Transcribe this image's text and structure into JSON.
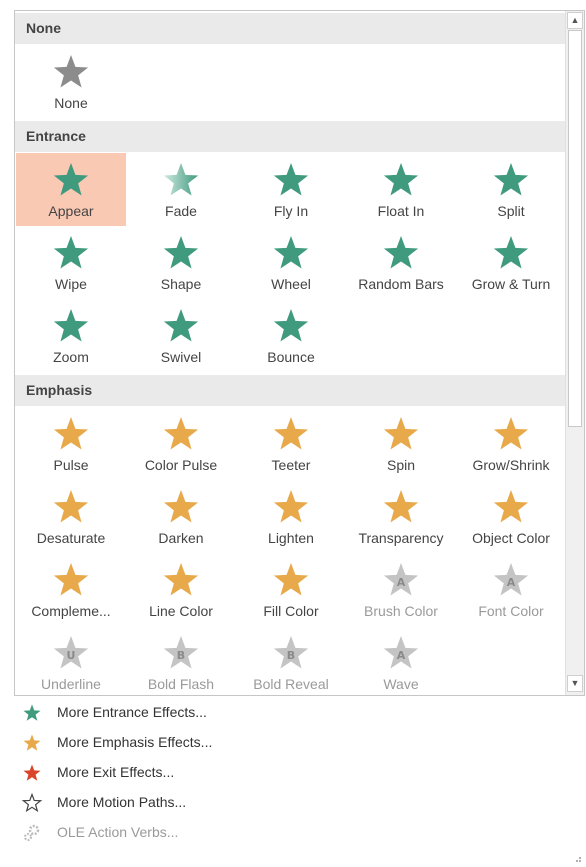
{
  "sections": [
    {
      "title": "None",
      "items": [
        {
          "label": "None",
          "kind": "none",
          "disabled": false,
          "selected": false
        }
      ]
    },
    {
      "title": "Entrance",
      "items": [
        {
          "label": "Appear",
          "kind": "entrance",
          "disabled": false,
          "selected": true
        },
        {
          "label": "Fade",
          "kind": "entrance",
          "disabled": false,
          "selected": false
        },
        {
          "label": "Fly In",
          "kind": "entrance",
          "disabled": false,
          "selected": false
        },
        {
          "label": "Float In",
          "kind": "entrance",
          "disabled": false,
          "selected": false
        },
        {
          "label": "Split",
          "kind": "entrance",
          "disabled": false,
          "selected": false
        },
        {
          "label": "Wipe",
          "kind": "entrance",
          "disabled": false,
          "selected": false
        },
        {
          "label": "Shape",
          "kind": "entrance",
          "disabled": false,
          "selected": false
        },
        {
          "label": "Wheel",
          "kind": "entrance",
          "disabled": false,
          "selected": false
        },
        {
          "label": "Random Bars",
          "kind": "entrance",
          "disabled": false,
          "selected": false
        },
        {
          "label": "Grow & Turn",
          "kind": "entrance",
          "disabled": false,
          "selected": false
        },
        {
          "label": "Zoom",
          "kind": "entrance",
          "disabled": false,
          "selected": false
        },
        {
          "label": "Swivel",
          "kind": "entrance",
          "disabled": false,
          "selected": false
        },
        {
          "label": "Bounce",
          "kind": "entrance",
          "disabled": false,
          "selected": false
        }
      ]
    },
    {
      "title": "Emphasis",
      "items": [
        {
          "label": "Pulse",
          "kind": "emphasis",
          "disabled": false,
          "selected": false
        },
        {
          "label": "Color Pulse",
          "kind": "emphasis",
          "disabled": false,
          "selected": false
        },
        {
          "label": "Teeter",
          "kind": "emphasis",
          "disabled": false,
          "selected": false
        },
        {
          "label": "Spin",
          "kind": "emphasis",
          "disabled": false,
          "selected": false
        },
        {
          "label": "Grow/Shrink",
          "kind": "emphasis",
          "disabled": false,
          "selected": false
        },
        {
          "label": "Desaturate",
          "kind": "emphasis",
          "disabled": false,
          "selected": false
        },
        {
          "label": "Darken",
          "kind": "emphasis",
          "disabled": false,
          "selected": false
        },
        {
          "label": "Lighten",
          "kind": "emphasis",
          "disabled": false,
          "selected": false
        },
        {
          "label": "Transparency",
          "kind": "emphasis",
          "disabled": false,
          "selected": false
        },
        {
          "label": "Object Color",
          "kind": "emphasis",
          "disabled": false,
          "selected": false
        },
        {
          "label": "Compleme...",
          "kind": "emphasis",
          "disabled": false,
          "selected": false
        },
        {
          "label": "Line Color",
          "kind": "emphasis",
          "disabled": false,
          "selected": false
        },
        {
          "label": "Fill Color",
          "kind": "emphasis",
          "disabled": false,
          "selected": false
        },
        {
          "label": "Brush Color",
          "kind": "emphasis-disabled",
          "disabled": true,
          "selected": false
        },
        {
          "label": "Font Color",
          "kind": "emphasis-disabled",
          "disabled": true,
          "selected": false
        },
        {
          "label": "Underline",
          "kind": "emphasis-disabled",
          "disabled": true,
          "selected": false
        },
        {
          "label": "Bold Flash",
          "kind": "emphasis-disabled",
          "disabled": true,
          "selected": false
        },
        {
          "label": "Bold Reveal",
          "kind": "emphasis-disabled",
          "disabled": true,
          "selected": false
        },
        {
          "label": "Wave",
          "kind": "emphasis-disabled",
          "disabled": true,
          "selected": false
        }
      ]
    }
  ],
  "more_items": [
    {
      "label": "More Entrance Effects...",
      "icon": "green-star-icon",
      "disabled": false
    },
    {
      "label": "More Emphasis Effects...",
      "icon": "gold-star-icon",
      "disabled": false
    },
    {
      "label": "More Exit Effects...",
      "icon": "red-star-icon",
      "disabled": false
    },
    {
      "label": "More Motion Paths...",
      "icon": "outline-star-icon",
      "disabled": false
    },
    {
      "label": "OLE Action Verbs...",
      "icon": "ole-gears-icon",
      "disabled": true
    }
  ],
  "colors": {
    "none_star": "#8c8c8c",
    "entrance": "#3f9a7e",
    "emphasis": "#e8a94a",
    "exit": "#d9452b",
    "disabled": "#c4c4c4",
    "selected_bg": "#f9c9b4",
    "header_bg": "#eaeaea"
  }
}
